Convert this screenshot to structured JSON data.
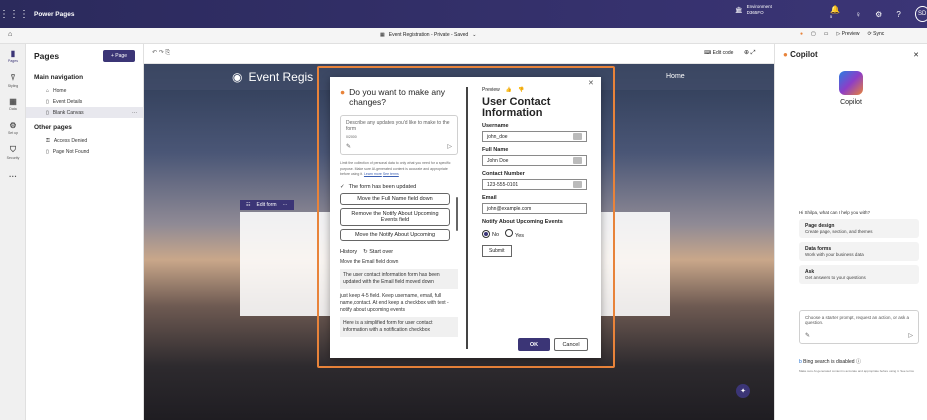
{
  "topbar": {
    "app_name": "Power Pages",
    "env_label": "Environment",
    "env_name": "D365FO",
    "avatar_initials": "SD",
    "notif_count": "5"
  },
  "cmdbar": {
    "site_title": "Event Registration - Private - Saved",
    "edit_code": "Edit code",
    "preview": "Preview",
    "sync": "Sync"
  },
  "rail": {
    "items": [
      "Pages",
      "Styling",
      "Data",
      "Set up",
      "Security",
      "More"
    ],
    "new_badge": "New"
  },
  "pages_panel": {
    "title": "Pages",
    "add_label": "+ Page",
    "main_nav": "Main navigation",
    "main_items": [
      "Home",
      "Event Details",
      "Blank Canvas"
    ],
    "other": "Other pages",
    "other_items": [
      "Access Denied",
      "Page Not Found"
    ]
  },
  "site": {
    "title": "Event Regis",
    "home": "Home",
    "edit_form": "Edit form"
  },
  "dialog": {
    "ask_title": "Do you want to make any changes?",
    "prompt_placeholder": "Describe any updates you'd like to make to the form",
    "prompt_count": "0/2000",
    "disclaimer": "Limit the collection of personal data to only what you need for a specific purpose. Make sure AI-generated content is accurate and appropriate before using it.",
    "learn_more": "Learn more",
    "see_terms": "See terms",
    "updated": "The form has been updated",
    "suggestions": [
      "Move the Full Name field down",
      "Remove the Notify About Upcoming Events field",
      "Move the Notify About Upcoming"
    ],
    "history_label": "History",
    "start_over": "Start over",
    "history": [
      {
        "prompt": "Move the Email field down",
        "response": "The user contact information form has been updated with the Email field moved down"
      },
      {
        "prompt": "just keep 4-5 field. Keep username, email, full name,contact. At end keep a checkbox with text -notify about upcoming events",
        "response": "Here is a simplified form for user contact information with a notification checkbox"
      }
    ],
    "preview_label": "Preview",
    "form_title": "User Contact Information",
    "fields": [
      {
        "label": "Username",
        "value": "john_doe"
      },
      {
        "label": "Full Name",
        "value": "John Doe"
      },
      {
        "label": "Contact Number",
        "value": "123-555-0101"
      },
      {
        "label": "Email",
        "value": "john@example.com"
      }
    ],
    "notify_label": "Notify About Upcoming Events",
    "radio_no": "No",
    "radio_yes": "Yes",
    "submit": "Submit",
    "ok": "OK",
    "cancel": "Cancel"
  },
  "copilot": {
    "title": "Copilot",
    "name": "Copilot",
    "greeting": "Hi Shilpa, what can I help you with?",
    "cards": [
      {
        "title": "Page design",
        "desc": "Create page, section, and themes"
      },
      {
        "title": "Data forms",
        "desc": "Work with your business data"
      },
      {
        "title": "Ask",
        "desc": "Get answers to your questions"
      }
    ],
    "input_placeholder": "Choose a starter prompt, request an action, or ask a question.",
    "bing": "Bing search is disabled",
    "footer": "Make sure AI-generated content is accurate and appropriate before using it. See terms"
  }
}
